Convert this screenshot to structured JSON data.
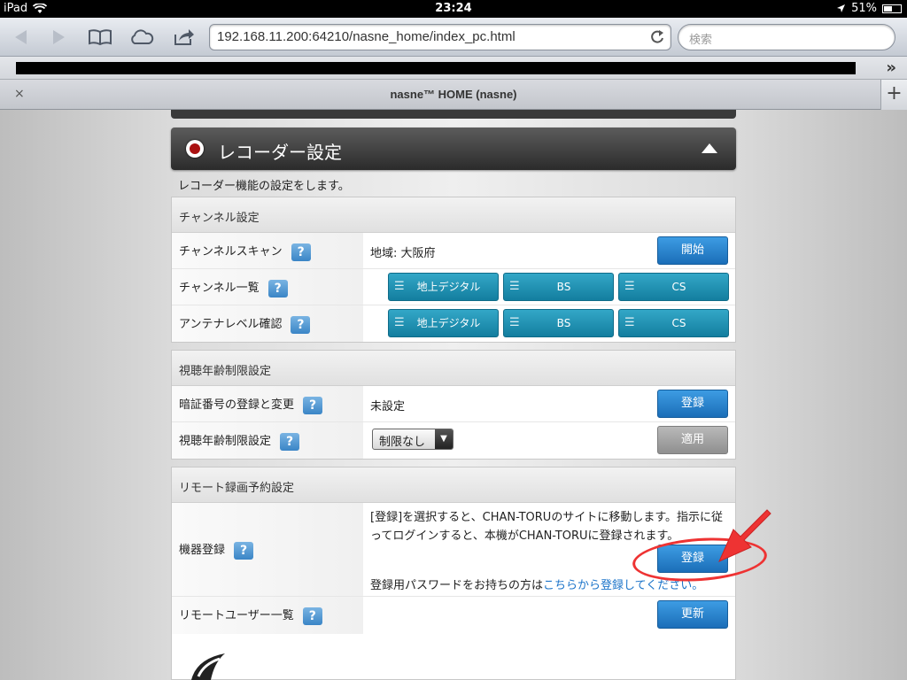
{
  "status_bar": {
    "device": "iPad",
    "time": "23:24",
    "battery": "51%",
    "battery_level": 0.51
  },
  "browser": {
    "url": "192.168.11.200:64210/nasne_home/index_pc.html",
    "search_placeholder": "検索",
    "tab_title": "nasne™ HOME (nasne)",
    "tab_close": "×",
    "tab_add": "+",
    "bookmarks_more": "»"
  },
  "section": {
    "title": "レコーダー設定",
    "description": "レコーダー機能の設定をします。"
  },
  "channel_settings": {
    "heading": "チャンネル設定",
    "rows": [
      {
        "label": "チャンネルスキャン",
        "value": "地域:  大阪府",
        "button": "開始"
      },
      {
        "label": "チャンネル一覧",
        "buttons": [
          "地上デジタル",
          "BS",
          "CS"
        ]
      },
      {
        "label": "アンテナレベル確認",
        "buttons": [
          "地上デジタル",
          "BS",
          "CS"
        ]
      }
    ]
  },
  "age_restriction": {
    "heading": "視聴年齢制限設定",
    "rows": [
      {
        "label": "暗証番号の登録と変更",
        "value": "未設定",
        "button": "登録"
      },
      {
        "label": "視聴年齢制限設定",
        "select_value": "制限なし",
        "button": "適用"
      }
    ]
  },
  "remote_recording": {
    "heading": "リモート録画予約設定",
    "rows": [
      {
        "label": "機器登録",
        "description": "[登録]を選択すると、CHAN-TORUのサイトに移動します。指示に従ってログインすると、本機がCHAN-TORUに登録されます。",
        "button": "登録",
        "password_text": "登録用パスワードをお持ちの方は",
        "password_link": "こちらから登録してください。"
      },
      {
        "label": "リモートユーザー一覧",
        "button": "更新"
      }
    ]
  },
  "help_glyph": "?",
  "colors": {
    "primary_button": "#1b6eb8",
    "teal_button": "#137e9f",
    "annotation": "#e33333",
    "link": "#1a73c9"
  }
}
